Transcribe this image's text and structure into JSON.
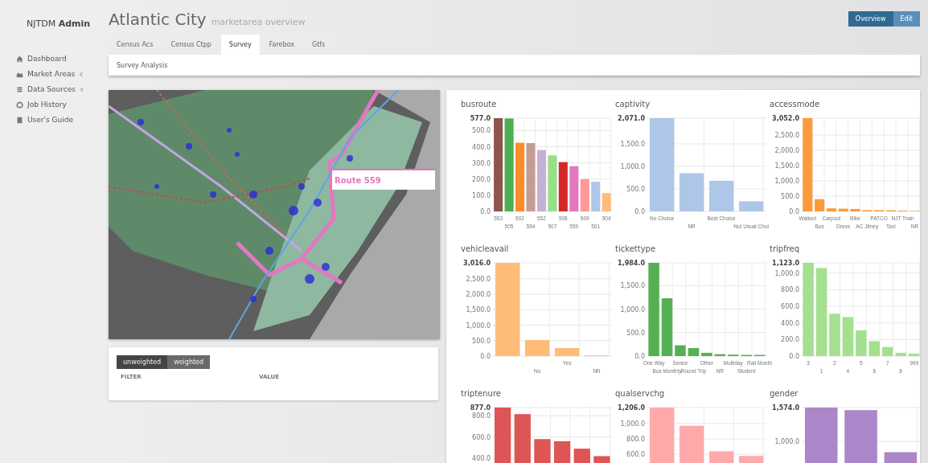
{
  "brand": {
    "name": "NJTDM",
    "bold": "Admin"
  },
  "sidebar": {
    "items": [
      {
        "label": "Dashboard",
        "submenu": false
      },
      {
        "label": "Market Areas",
        "submenu": true
      },
      {
        "label": "Data Sources",
        "submenu": true
      },
      {
        "label": "Job History",
        "submenu": false
      },
      {
        "label": "User's Guide",
        "submenu": false
      }
    ]
  },
  "header": {
    "title": "Atlantic City",
    "subtitle": "marketarea overview"
  },
  "view_buttons": [
    {
      "label": "Overview",
      "selected": true
    },
    {
      "label": "Edit",
      "selected": false
    }
  ],
  "tabs": [
    {
      "label": "Census Acs",
      "selected": false
    },
    {
      "label": "Census Ctpp",
      "selected": false
    },
    {
      "label": "Survey",
      "selected": true
    },
    {
      "label": "Farebox",
      "selected": false
    },
    {
      "label": "Gtfs",
      "selected": false
    }
  ],
  "subtab": "Survey Analysis",
  "map": {
    "tooltip": "Route 559"
  },
  "weighting": [
    {
      "label": "unweighted",
      "selected": true
    },
    {
      "label": "weighted",
      "selected": false
    }
  ],
  "filter_table": {
    "columns": [
      "FILTER",
      "VALUE"
    ]
  },
  "charts": [
    {
      "chart_data": {
        "type": "bar",
        "title": "busroute",
        "grid": true,
        "categories": [
          "553",
          "505",
          "502",
          "554",
          "552",
          "507",
          "508",
          "559",
          "509",
          "501",
          "504"
        ],
        "series": [
          {
            "values": [
              577,
              575,
              425,
              423,
              380,
              347,
              305,
              280,
              200,
              183,
              113
            ]
          }
        ],
        "colors": [
          "#8c564b",
          "#4caf50",
          "#ff8c2a",
          "#c49c94",
          "#c5b0d5",
          "#98df8a",
          "#d62728",
          "#e377c2",
          "#ff9896",
          "#aec7e8",
          "#ffbb78"
        ],
        "ylim": [
          0,
          577
        ],
        "yticks": [
          {
            "value": 0,
            "label": "0.0"
          },
          {
            "value": 100,
            "label": "100.0"
          },
          {
            "value": 200,
            "label": "200.0"
          },
          {
            "value": 300,
            "label": "300.0"
          },
          {
            "value": 400,
            "label": "400.0"
          },
          {
            "value": 500,
            "label": "500.0"
          },
          {
            "value": 577,
            "label": "577.0"
          }
        ]
      }
    },
    {
      "chart_data": {
        "type": "bar",
        "title": "captivity",
        "grid": true,
        "categories": [
          "No Choice",
          "NR",
          "Best Choice",
          "Not Usual Choi"
        ],
        "series": [
          {
            "color": "#aec7e8",
            "values": [
              2071,
              850,
              680,
              225
            ]
          }
        ],
        "ylim": [
          0,
          2071
        ],
        "yticks": [
          {
            "value": 0,
            "label": "0.0"
          },
          {
            "value": 500,
            "label": "500.0"
          },
          {
            "value": 1000,
            "label": "1,000.0"
          },
          {
            "value": 1500,
            "label": "1,500.0"
          },
          {
            "value": 2071,
            "label": "2,071.0"
          }
        ]
      }
    },
    {
      "chart_data": {
        "type": "bar",
        "title": "accessmode",
        "grid": true,
        "categories": [
          "Walked",
          "Bus",
          "Carpool",
          "Drove",
          "Bike",
          "AC Jitney",
          "PATCO",
          "Taxi",
          "NJT Train",
          "NR"
        ],
        "series": [
          {
            "color": "#fd9a3a",
            "values": [
              3052,
              400,
              100,
              90,
              80,
              40,
              40,
              35,
              25,
              15
            ]
          }
        ],
        "ylim": [
          0,
          3052
        ],
        "yticks": [
          {
            "value": 0,
            "label": "0.0"
          },
          {
            "value": 500,
            "label": "500.0"
          },
          {
            "value": 1000,
            "label": "1,000.0"
          },
          {
            "value": 1500,
            "label": "1,500.0"
          },
          {
            "value": 2000,
            "label": "2,000.0"
          },
          {
            "value": 2500,
            "label": "2,500.0"
          },
          {
            "value": 3052,
            "label": "3,052.0"
          }
        ]
      }
    },
    {
      "chart_data": {
        "type": "bar",
        "title": "vehicleavail",
        "grid": true,
        "categories": [
          null,
          "No",
          "Yes",
          "NR"
        ],
        "series": [
          {
            "color": "#ffbb78",
            "values": [
              3016,
              520,
              260,
              25
            ]
          }
        ],
        "ylim": [
          0,
          3016
        ],
        "yticks": [
          {
            "value": 0,
            "label": "0.0"
          },
          {
            "value": 500,
            "label": "500.0"
          },
          {
            "value": 1000,
            "label": "1,000.0"
          },
          {
            "value": 1500,
            "label": "1,500.0"
          },
          {
            "value": 2000,
            "label": "2,000.0"
          },
          {
            "value": 2500,
            "label": "2,500.0"
          },
          {
            "value": 3016,
            "label": "3,016.0"
          }
        ]
      }
    },
    {
      "chart_data": {
        "type": "bar",
        "title": "tickettype",
        "grid": true,
        "categories": [
          "One Way",
          "Bus Monthly",
          "Senior",
          "Round Trip",
          "Other",
          "NR",
          "Multiday",
          "Student",
          "Rail Month"
        ],
        "series": [
          {
            "color": "#55b054",
            "values": [
              1984,
              1230,
              230,
              170,
              70,
              40,
              30,
              25,
              25
            ]
          }
        ],
        "ylim": [
          0,
          1984
        ],
        "yticks": [
          {
            "value": 0,
            "label": "0.0"
          },
          {
            "value": 500,
            "label": "500.0"
          },
          {
            "value": 1000,
            "label": "1,000.0"
          },
          {
            "value": 1500,
            "label": "1,500.0"
          },
          {
            "value": 1984,
            "label": "1,984.0"
          }
        ]
      }
    },
    {
      "chart_data": {
        "type": "bar",
        "title": "tripfreq",
        "grid": true,
        "categories": [
          "3",
          "1",
          "2",
          "4",
          "5",
          "6",
          "7",
          "8",
          "999"
        ],
        "series": [
          {
            "color": "#a4e08f",
            "values": [
              1123,
              1060,
              510,
              470,
              310,
              180,
              110,
              40,
              30
            ]
          }
        ],
        "ylim": [
          0,
          1123
        ],
        "yticks": [
          {
            "value": 0,
            "label": "0.0"
          },
          {
            "value": 200,
            "label": "200.0"
          },
          {
            "value": 400,
            "label": "400.0"
          },
          {
            "value": 600,
            "label": "600.0"
          },
          {
            "value": 800,
            "label": "800.0"
          },
          {
            "value": 1000,
            "label": "1,000.0"
          },
          {
            "value": 1123,
            "label": "1,123.0"
          }
        ]
      }
    },
    {
      "chart_data": {
        "type": "bar",
        "title": "triptenure",
        "grid": true,
        "series": [
          {
            "color": "#dd5555",
            "values": [
              877,
              815,
              580,
              560,
              490,
              420
            ]
          }
        ],
        "ylim": [
          0,
          877
        ],
        "yticks": [
          {
            "value": 400,
            "label": "400.0"
          },
          {
            "value": 600,
            "label": "600.0"
          },
          {
            "value": 800,
            "label": "800.0"
          },
          {
            "value": 877,
            "label": "877.0"
          }
        ]
      }
    },
    {
      "chart_data": {
        "type": "bar",
        "title": "qualservchg",
        "grid": true,
        "series": [
          {
            "color": "#ffaaaa",
            "values": [
              1206,
              970,
              640,
              580
            ]
          }
        ],
        "ylim": [
          0,
          1206
        ],
        "yticks": [
          {
            "value": 600,
            "label": "600.0"
          },
          {
            "value": 800,
            "label": "800.0"
          },
          {
            "value": 1000,
            "label": "1,000.0"
          },
          {
            "value": 1206,
            "label": "1,206.0"
          }
        ]
      }
    },
    {
      "chart_data": {
        "type": "bar",
        "title": "gender",
        "grid": true,
        "series": [
          {
            "color": "#ab86c9",
            "values": [
              1574,
              1530,
              820
            ]
          }
        ],
        "ylim": [
          0,
          1574
        ],
        "yticks": [
          {
            "value": 1000,
            "label": "1,000.0"
          },
          {
            "value": 1574,
            "label": "1,574.0"
          }
        ]
      }
    }
  ]
}
